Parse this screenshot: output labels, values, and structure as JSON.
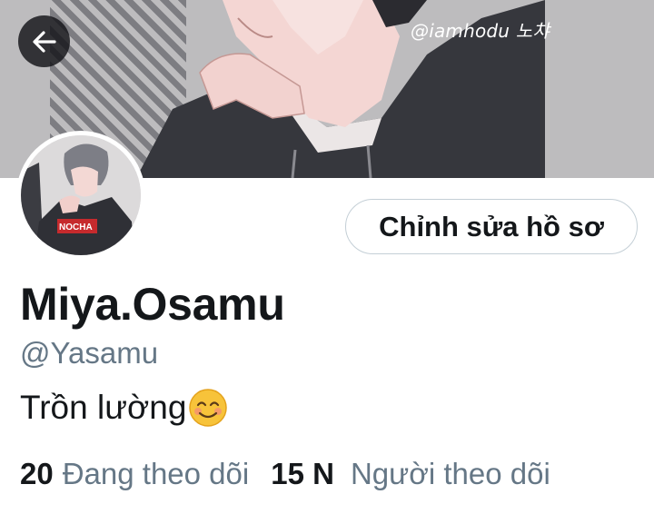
{
  "banner": {
    "watermark": "@iamhodu 노챠"
  },
  "avatar": {
    "shirt_text": "NOCHA"
  },
  "profile": {
    "edit_button_label": "Chỉnh sửa hồ sơ",
    "display_name": "Miya.Osamu",
    "handle": "@Yasamu",
    "bio": "Trồn lườn",
    "bio_last_char": "g",
    "bio_emoji": "smiling-face-emoji"
  },
  "stats": {
    "following_count": "20",
    "following_label": "Đang theo dõi",
    "followers_count": "15 N",
    "followers_label": "Người theo dõi"
  },
  "icons": {
    "back": "arrow-left-icon"
  },
  "colors": {
    "text_primary": "#14171a",
    "text_secondary": "#657786",
    "button_border": "#c4cfd6",
    "back_button_bg": "#1d1d22",
    "banner_bg": "#bdbcbe"
  }
}
